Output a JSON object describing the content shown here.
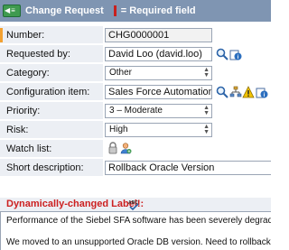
{
  "header": {
    "title": "Change Request",
    "required_legend": "= Required field",
    "accent_color": "#7f95b2",
    "required_color": "#c8201e"
  },
  "fields": {
    "number": {
      "label": "Number:",
      "value": "CHG0000001"
    },
    "requested_by": {
      "label": "Requested by:",
      "value": "David Loo (david.loo)"
    },
    "category": {
      "label": "Category:",
      "value": "Other"
    },
    "configuration_item": {
      "label": "Configuration item:",
      "value": "Sales Force Automation"
    },
    "priority": {
      "label": "Priority:",
      "value": "3 – Moderate"
    },
    "risk": {
      "label": "Risk:",
      "value": "High"
    },
    "watch_list": {
      "label": "Watch list:"
    },
    "short_description": {
      "label": "Short description:",
      "value": "Rollback Oracle Version"
    }
  },
  "dynamic_label": {
    "text": "Dynamically-changed Label!:"
  },
  "description": {
    "line1": "Performance of the Siebel SFA software has been severely degraded",
    "line2": "We moved to an unsupported Oracle DB version.  Need to rollback t"
  },
  "icons": [
    "back-arrow-icon",
    "search-icon",
    "reference-info-icon",
    "tree-icon",
    "warning-icon",
    "lock-icon",
    "user-add-icon",
    "spell-check-icon"
  ]
}
